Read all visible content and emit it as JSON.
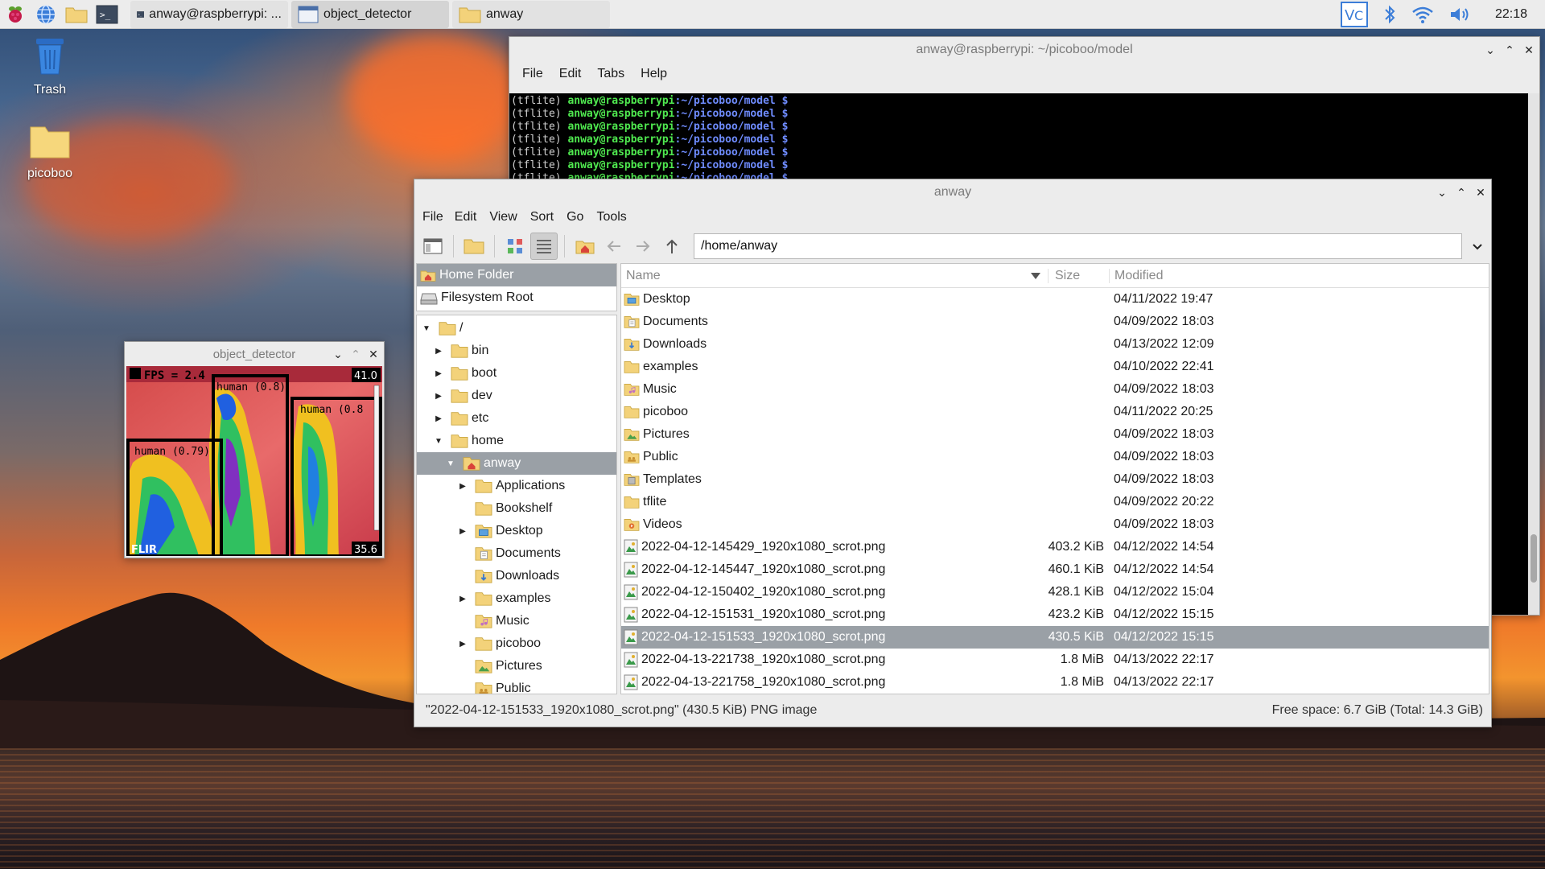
{
  "taskbar": {
    "tasks": [
      {
        "label": "anway@raspberrypi: ..."
      },
      {
        "label": "object_detector"
      },
      {
        "label": "anway"
      }
    ],
    "clock": "22:18"
  },
  "desktop": {
    "icons": [
      {
        "label": "Trash",
        "icon": "trash-icon"
      },
      {
        "label": "picoboo",
        "icon": "folder-icon"
      }
    ]
  },
  "terminal": {
    "title": "anway@raspberrypi: ~/picoboo/model",
    "menu": [
      "File",
      "Edit",
      "Tabs",
      "Help"
    ],
    "lines": [
      {
        "env": "(tflite)",
        "user": "anway@raspberrypi",
        "path": ":~/picoboo/model",
        "prompt": "$"
      },
      {
        "env": "(tflite)",
        "user": "anway@raspberrypi",
        "path": ":~/picoboo/model",
        "prompt": "$"
      },
      {
        "env": "(tflite)",
        "user": "anway@raspberrypi",
        "path": ":~/picoboo/model",
        "prompt": "$"
      },
      {
        "env": "(tflite)",
        "user": "anway@raspberrypi",
        "path": ":~/picoboo/model",
        "prompt": "$"
      },
      {
        "env": "(tflite)",
        "user": "anway@raspberrypi",
        "path": ":~/picoboo/model",
        "prompt": "$"
      },
      {
        "env": "(tflite)",
        "user": "anway@raspberrypi",
        "path": ":~/picoboo/model",
        "prompt": "$"
      },
      {
        "env": "(tflite)",
        "user": "anway@raspberrypi",
        "path": ":~/picoboo/model",
        "prompt": "$"
      }
    ]
  },
  "object_detector": {
    "title": "object_detector",
    "fps": "FPS = 2.4",
    "temp_max": "41.0",
    "temp_min": "35.6",
    "brand": "FLIR",
    "detections": [
      {
        "label": "human (0.8)"
      },
      {
        "label": "human (0.8"
      },
      {
        "label": "human (0.79)"
      }
    ]
  },
  "filemanager": {
    "title": "anway",
    "menu": [
      "File",
      "Edit",
      "View",
      "Sort",
      "Go",
      "Tools"
    ],
    "path": "/home/anway",
    "places": [
      {
        "label": "Home Folder",
        "icon": "home-icon"
      },
      {
        "label": "Filesystem Root",
        "icon": "drive-icon"
      }
    ],
    "tree": [
      {
        "label": "/",
        "arrow": "▼"
      },
      {
        "label": "bin",
        "arrow": "▶"
      },
      {
        "label": "boot",
        "arrow": "▶"
      },
      {
        "label": "dev",
        "arrow": "▶"
      },
      {
        "label": "etc",
        "arrow": "▶"
      },
      {
        "label": "home",
        "arrow": "▼"
      },
      {
        "label": "anway",
        "arrow": "▼"
      },
      {
        "label": "Applications",
        "arrow": "▶"
      },
      {
        "label": "Bookshelf",
        "arrow": ""
      },
      {
        "label": "Desktop",
        "arrow": "▶"
      },
      {
        "label": "Documents",
        "arrow": ""
      },
      {
        "label": "Downloads",
        "arrow": ""
      },
      {
        "label": "examples",
        "arrow": "▶"
      },
      {
        "label": "Music",
        "arrow": ""
      },
      {
        "label": "picoboo",
        "arrow": "▶"
      },
      {
        "label": "Pictures",
        "arrow": ""
      },
      {
        "label": "Public",
        "arrow": ""
      }
    ],
    "columns": {
      "name": "Name",
      "size": "Size",
      "modified": "Modified"
    },
    "files": [
      {
        "name": "Desktop",
        "size": "",
        "modified": "04/11/2022 19:47",
        "icon": "folder-desktop-icon"
      },
      {
        "name": "Documents",
        "size": "",
        "modified": "04/09/2022 18:03",
        "icon": "folder-documents-icon"
      },
      {
        "name": "Downloads",
        "size": "",
        "modified": "04/13/2022 12:09",
        "icon": "folder-downloads-icon"
      },
      {
        "name": "examples",
        "size": "",
        "modified": "04/10/2022 22:41",
        "icon": "folder-icon"
      },
      {
        "name": "Music",
        "size": "",
        "modified": "04/09/2022 18:03",
        "icon": "folder-music-icon"
      },
      {
        "name": "picoboo",
        "size": "",
        "modified": "04/11/2022 20:25",
        "icon": "folder-icon"
      },
      {
        "name": "Pictures",
        "size": "",
        "modified": "04/09/2022 18:03",
        "icon": "folder-pictures-icon"
      },
      {
        "name": "Public",
        "size": "",
        "modified": "04/09/2022 18:03",
        "icon": "folder-public-icon"
      },
      {
        "name": "Templates",
        "size": "",
        "modified": "04/09/2022 18:03",
        "icon": "folder-templates-icon"
      },
      {
        "name": "tflite",
        "size": "",
        "modified": "04/09/2022 20:22",
        "icon": "folder-icon"
      },
      {
        "name": "Videos",
        "size": "",
        "modified": "04/09/2022 18:03",
        "icon": "folder-videos-icon"
      },
      {
        "name": "2022-04-12-145429_1920x1080_scrot.png",
        "size": "403.2 KiB",
        "modified": "04/12/2022 14:54",
        "icon": "image-file-icon"
      },
      {
        "name": "2022-04-12-145447_1920x1080_scrot.png",
        "size": "460.1 KiB",
        "modified": "04/12/2022 14:54",
        "icon": "image-file-icon"
      },
      {
        "name": "2022-04-12-150402_1920x1080_scrot.png",
        "size": "428.1 KiB",
        "modified": "04/12/2022 15:04",
        "icon": "image-file-icon"
      },
      {
        "name": "2022-04-12-151531_1920x1080_scrot.png",
        "size": "423.2 KiB",
        "modified": "04/12/2022 15:15",
        "icon": "image-file-icon"
      },
      {
        "name": "2022-04-12-151533_1920x1080_scrot.png",
        "size": "430.5 KiB",
        "modified": "04/12/2022 15:15",
        "icon": "image-file-icon",
        "selected": true
      },
      {
        "name": "2022-04-13-221738_1920x1080_scrot.png",
        "size": "1.8 MiB",
        "modified": "04/13/2022 22:17",
        "icon": "image-file-icon"
      },
      {
        "name": "2022-04-13-221758_1920x1080_scrot.png",
        "size": "1.8 MiB",
        "modified": "04/13/2022 22:17",
        "icon": "image-file-icon"
      }
    ],
    "status_left": "\"2022-04-12-151533_1920x1080_scrot.png\" (430.5 KiB) PNG image",
    "status_right": "Free space: 6.7 GiB (Total: 14.3 GiB)"
  }
}
